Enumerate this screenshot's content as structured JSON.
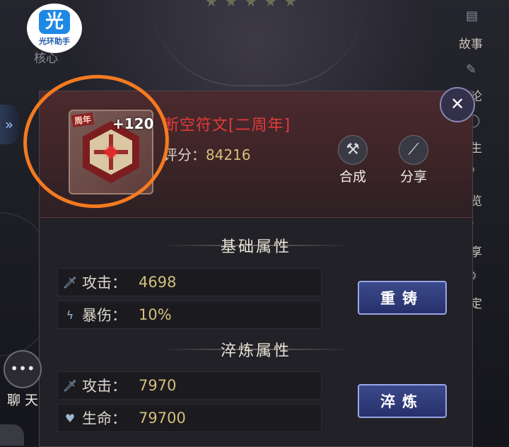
{
  "logo": {
    "mark": "光",
    "text": "光环助手"
  },
  "background_label": "核心",
  "item": {
    "tag": "周年",
    "level": "+120",
    "name": "断空符文[二周年]",
    "score_label": "评分：",
    "score_value": "84216"
  },
  "header_buttons": [
    {
      "label": "合成",
      "icon": "anvil-icon"
    },
    {
      "label": "分享",
      "icon": "share-icon"
    }
  ],
  "sections": {
    "basic": {
      "title": "基础属性",
      "stats": [
        {
          "icon": "sword-icon",
          "label": "攻击：",
          "value": "4698"
        },
        {
          "icon": "lightning-icon",
          "label": "暴伤：",
          "value": "10%"
        }
      ],
      "button": "重铸"
    },
    "refine": {
      "title": "淬炼属性",
      "stats": [
        {
          "icon": "sword-icon",
          "label": "攻击：",
          "value": "7970"
        },
        {
          "icon": "heart-icon",
          "label": "生命：",
          "value": "79700"
        }
      ],
      "button": "淬炼"
    }
  },
  "side_nav": [
    "故事",
    "论",
    "生",
    "览",
    "享",
    "定"
  ],
  "chat_label": "聊 天",
  "colors": {
    "accent": "#f47a20",
    "gold": "#d4bf7a",
    "item_name": "#e33a3a"
  }
}
